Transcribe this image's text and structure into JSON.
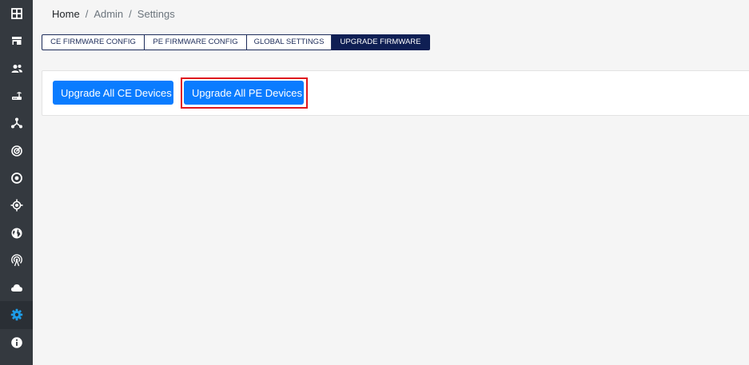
{
  "sidebar": {
    "items": [
      {
        "icon": "dashboard-grid-icon"
      },
      {
        "icon": "storefront-icon"
      },
      {
        "icon": "users-icon"
      },
      {
        "icon": "router-icon"
      },
      {
        "icon": "network-topology-icon"
      },
      {
        "icon": "radar-icon"
      },
      {
        "icon": "target-circle-icon"
      },
      {
        "icon": "gps-location-icon"
      },
      {
        "icon": "globe-icon"
      },
      {
        "icon": "antenna-icon"
      },
      {
        "icon": "cloud-icon"
      },
      {
        "icon": "gear-icon",
        "active": true
      },
      {
        "icon": "info-icon"
      }
    ],
    "icon_color": "#ffffff",
    "active_icon_color": "#1e9de8"
  },
  "breadcrumb": {
    "home": "Home",
    "separator": "/",
    "admin": "Admin",
    "current": "Settings"
  },
  "tabs": [
    {
      "label": "CE FIRMWARE CONFIG"
    },
    {
      "label": "PE FIRMWARE CONFIG"
    },
    {
      "label": "GLOBAL SETTINGS"
    },
    {
      "label": "UPGRADE FIRMWARE",
      "active": true
    }
  ],
  "actions": {
    "upgrade_ce_label": "Upgrade All CE Devices",
    "upgrade_pe_label": "Upgrade All PE Devices"
  },
  "colors": {
    "accent": "#0a7cff",
    "tab_active": "#0f1f54",
    "highlight": "#e0151d"
  }
}
